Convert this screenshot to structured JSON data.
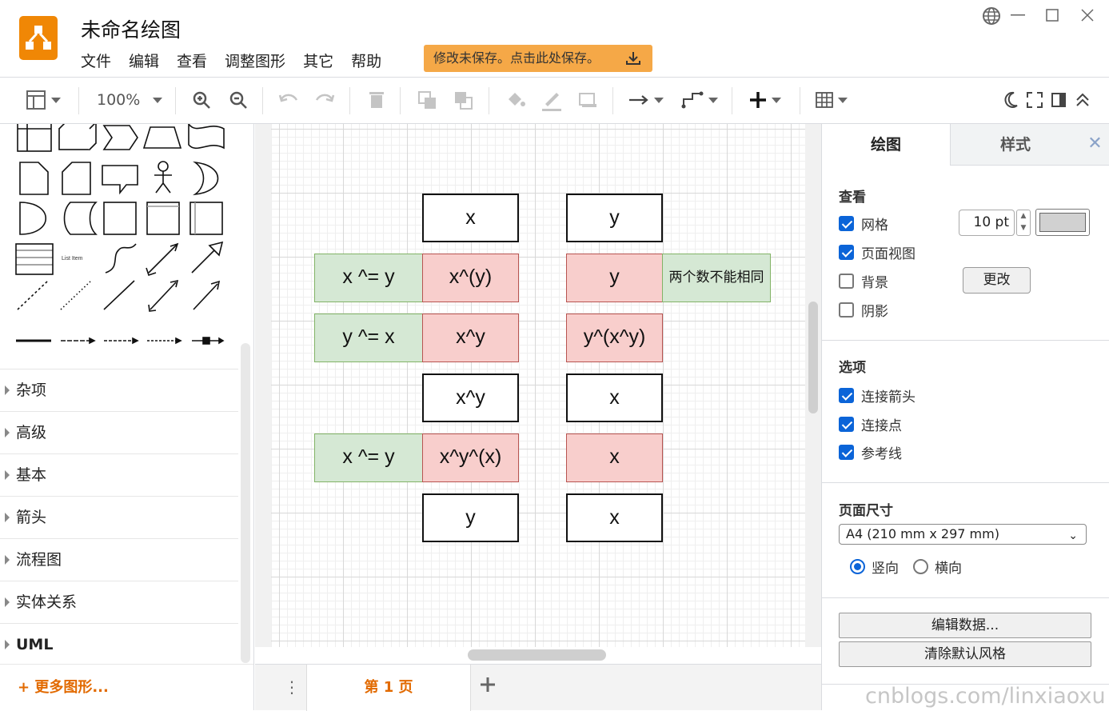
{
  "app": {
    "title": "未命名绘图",
    "unsaved_notice": "修改未保存。点击此处保存。"
  },
  "menu": [
    "文件",
    "编辑",
    "查看",
    "调整图形",
    "其它",
    "帮助"
  ],
  "toolbar": {
    "zoom": "100%"
  },
  "sidebar": {
    "sections": [
      "杂项",
      "高级",
      "基本",
      "箭头",
      "流程图",
      "实体关系",
      "UML"
    ],
    "more_shapes": "+ 更多图形...",
    "list_item_label": "List Item"
  },
  "diagram": {
    "cells": [
      {
        "text": "x",
        "style": "plain"
      },
      {
        "text": "y",
        "style": "plain"
      },
      {
        "text": "x ^= y",
        "style": "green"
      },
      {
        "text": "x^(y)",
        "style": "red"
      },
      {
        "text": "y",
        "style": "red"
      },
      {
        "text": "两个数不能相同",
        "style": "green"
      },
      {
        "text": "y ^= x",
        "style": "green"
      },
      {
        "text": "x^y",
        "style": "red"
      },
      {
        "text": "y^(x^y)",
        "style": "red"
      },
      {
        "text": "x^y",
        "style": "plain"
      },
      {
        "text": "x",
        "style": "plain"
      },
      {
        "text": "x ^= y",
        "style": "green"
      },
      {
        "text": "x^y^(x)",
        "style": "red"
      },
      {
        "text": "x",
        "style": "red"
      },
      {
        "text": "y",
        "style": "plain"
      },
      {
        "text": "x",
        "style": "plain"
      }
    ]
  },
  "pages": {
    "current": "第 1 页"
  },
  "panel": {
    "tabs": [
      "绘图",
      "样式"
    ],
    "view_heading": "查看",
    "grid_label": "网格",
    "grid_checked": true,
    "grid_size": "10 pt",
    "grid_color": "#d1d1d1",
    "page_view_label": "页面视图",
    "page_view_checked": true,
    "background_label": "背景",
    "background_checked": false,
    "change_button": "更改",
    "shadow_label": "阴影",
    "shadow_checked": false,
    "options_heading": "选项",
    "connection_arrows_label": "连接箭头",
    "connection_arrows_checked": true,
    "connection_points_label": "连接点",
    "connection_points_checked": true,
    "guides_label": "参考线",
    "guides_checked": true,
    "page_size_heading": "页面尺寸",
    "page_size_value": "A4 (210 mm x 297 mm)",
    "portrait_label": "竖向",
    "portrait_selected": true,
    "landscape_label": "横向",
    "landscape_selected": false,
    "edit_data_button": "编辑数据...",
    "clear_style_button": "清除默认风格"
  },
  "watermark": "cnblogs.com/linxiaoxu"
}
